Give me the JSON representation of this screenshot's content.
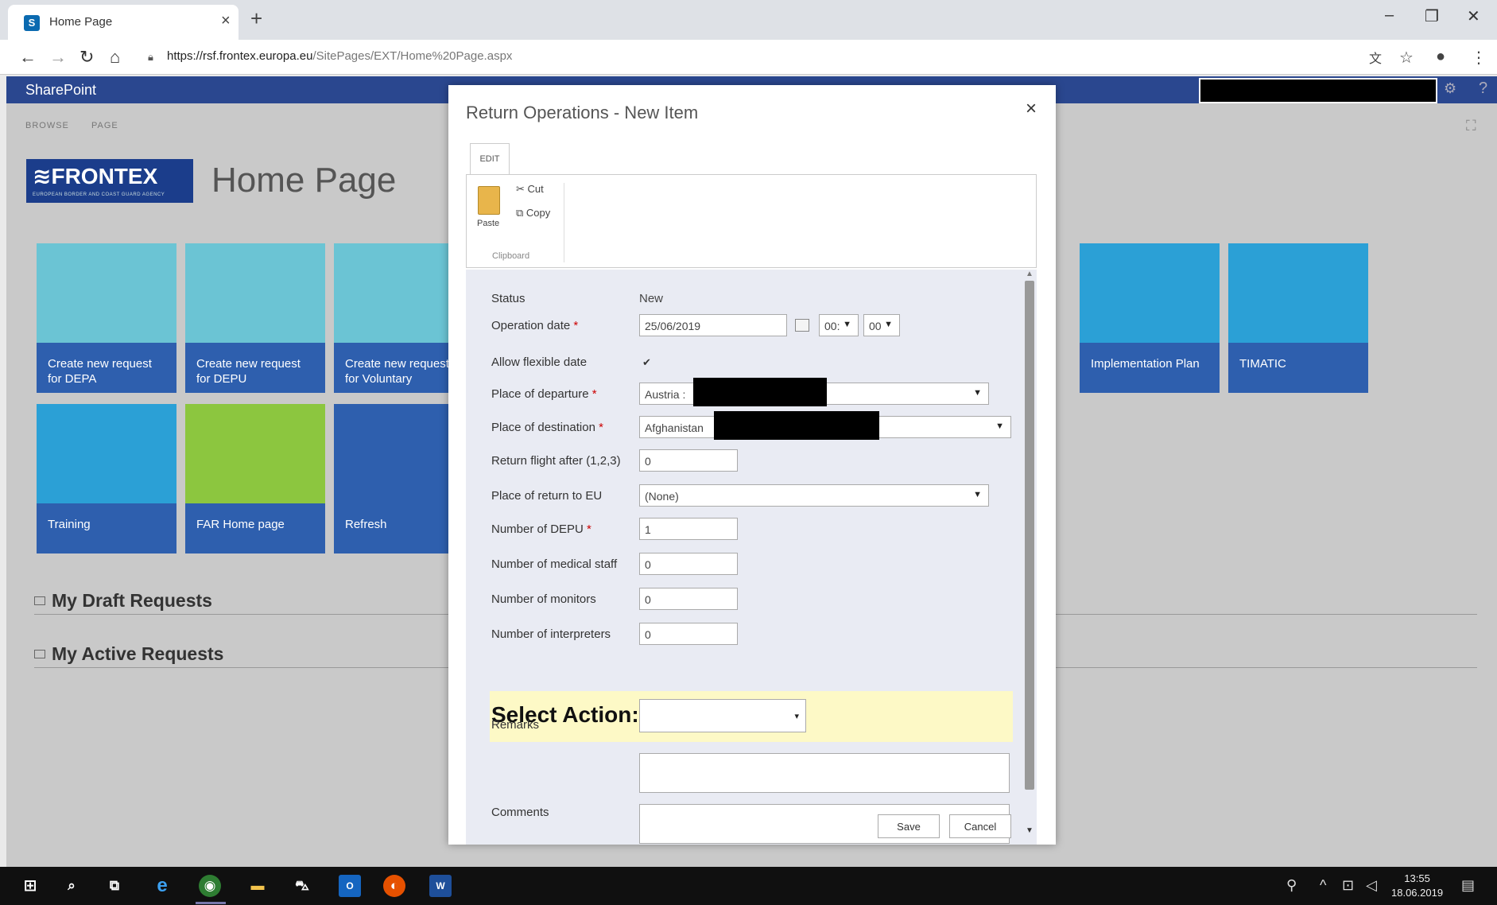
{
  "browser": {
    "tab_title": "Home Page",
    "tab_close": "×",
    "new_tab": "+",
    "url_host": "https://rsf.frontex.europa.eu",
    "url_path": "/SitePages/EXT/Home%20Page.aspx",
    "min": "–",
    "max": "❐",
    "close": "✕"
  },
  "sharepoint": {
    "brand": "SharePoint",
    "ribbon_tabs": [
      "BROWSE",
      "PAGE"
    ],
    "logo_text": "≋FRONTEX",
    "logo_sub": "EUROPEAN BORDER AND COAST GUARD AGENCY",
    "page_title": "Home Page",
    "tiles": [
      {
        "label": "Create new request for DEPA",
        "top_color": "#6bc4d4",
        "bottom_color": "#2e5fae"
      },
      {
        "label": "Create new request for DEPU",
        "top_color": "#6bc4d4",
        "bottom_color": "#2e5fae"
      },
      {
        "label": "Create new request for Voluntary",
        "top_color": "#6bc4d4",
        "bottom_color": "#2e5fae"
      },
      {
        "label": "Implementation Plan",
        "top_color": "#2ba0d6",
        "bottom_color": "#2e5fae"
      },
      {
        "label": "TIMATIC",
        "top_color": "#2ba0d6",
        "bottom_color": "#2e5fae"
      },
      {
        "label": "Training",
        "top_color": "#2ba0d6",
        "bottom_color": "#2e5fae"
      },
      {
        "label": "FAR Home page",
        "top_color": "#8cc63f",
        "bottom_color": "#2e5fae"
      },
      {
        "label": "Refresh",
        "top_color": "#2e5fae",
        "bottom_color": "#2e5fae"
      }
    ],
    "sections": [
      "My Draft Requests",
      "My Active Requests"
    ]
  },
  "dialog": {
    "title": "Return Operations - New Item",
    "close": "×",
    "ribbon": {
      "tab": "EDIT",
      "paste": "Paste",
      "cut": "Cut",
      "copy": "Copy",
      "group": "Clipboard"
    },
    "fields": {
      "status": {
        "label": "Status",
        "value": "New"
      },
      "operation_date": {
        "label": "Operation date",
        "date": "25/06/2019",
        "hour": "00:",
        "minute": "00"
      },
      "flexible": {
        "label": "Allow flexible date",
        "checked": "✔"
      },
      "departure": {
        "label": "Place of departure",
        "value": "Austria :"
      },
      "destination": {
        "label": "Place of destination",
        "value": "Afghanistan"
      },
      "return_flight": {
        "label": "Return flight after (1,2,3)",
        "value": "0"
      },
      "return_eu": {
        "label": "Place of return to EU",
        "value": "(None)"
      },
      "depu": {
        "label": "Number of DEPU",
        "value": "1"
      },
      "medical": {
        "label": "Number of medical staff",
        "value": "0"
      },
      "monitors": {
        "label": "Number of monitors",
        "value": "0"
      },
      "interpreters": {
        "label": "Number of interpreters",
        "value": "0"
      },
      "action": {
        "label": "Select Action:",
        "value": ""
      },
      "remarks": {
        "label": "Remarks"
      },
      "comments": {
        "label": "Comments"
      }
    },
    "required_mark": "*",
    "save": "Save",
    "cancel": "Cancel"
  },
  "taskbar": {
    "time": "13:55",
    "date": "18.06.2019"
  }
}
